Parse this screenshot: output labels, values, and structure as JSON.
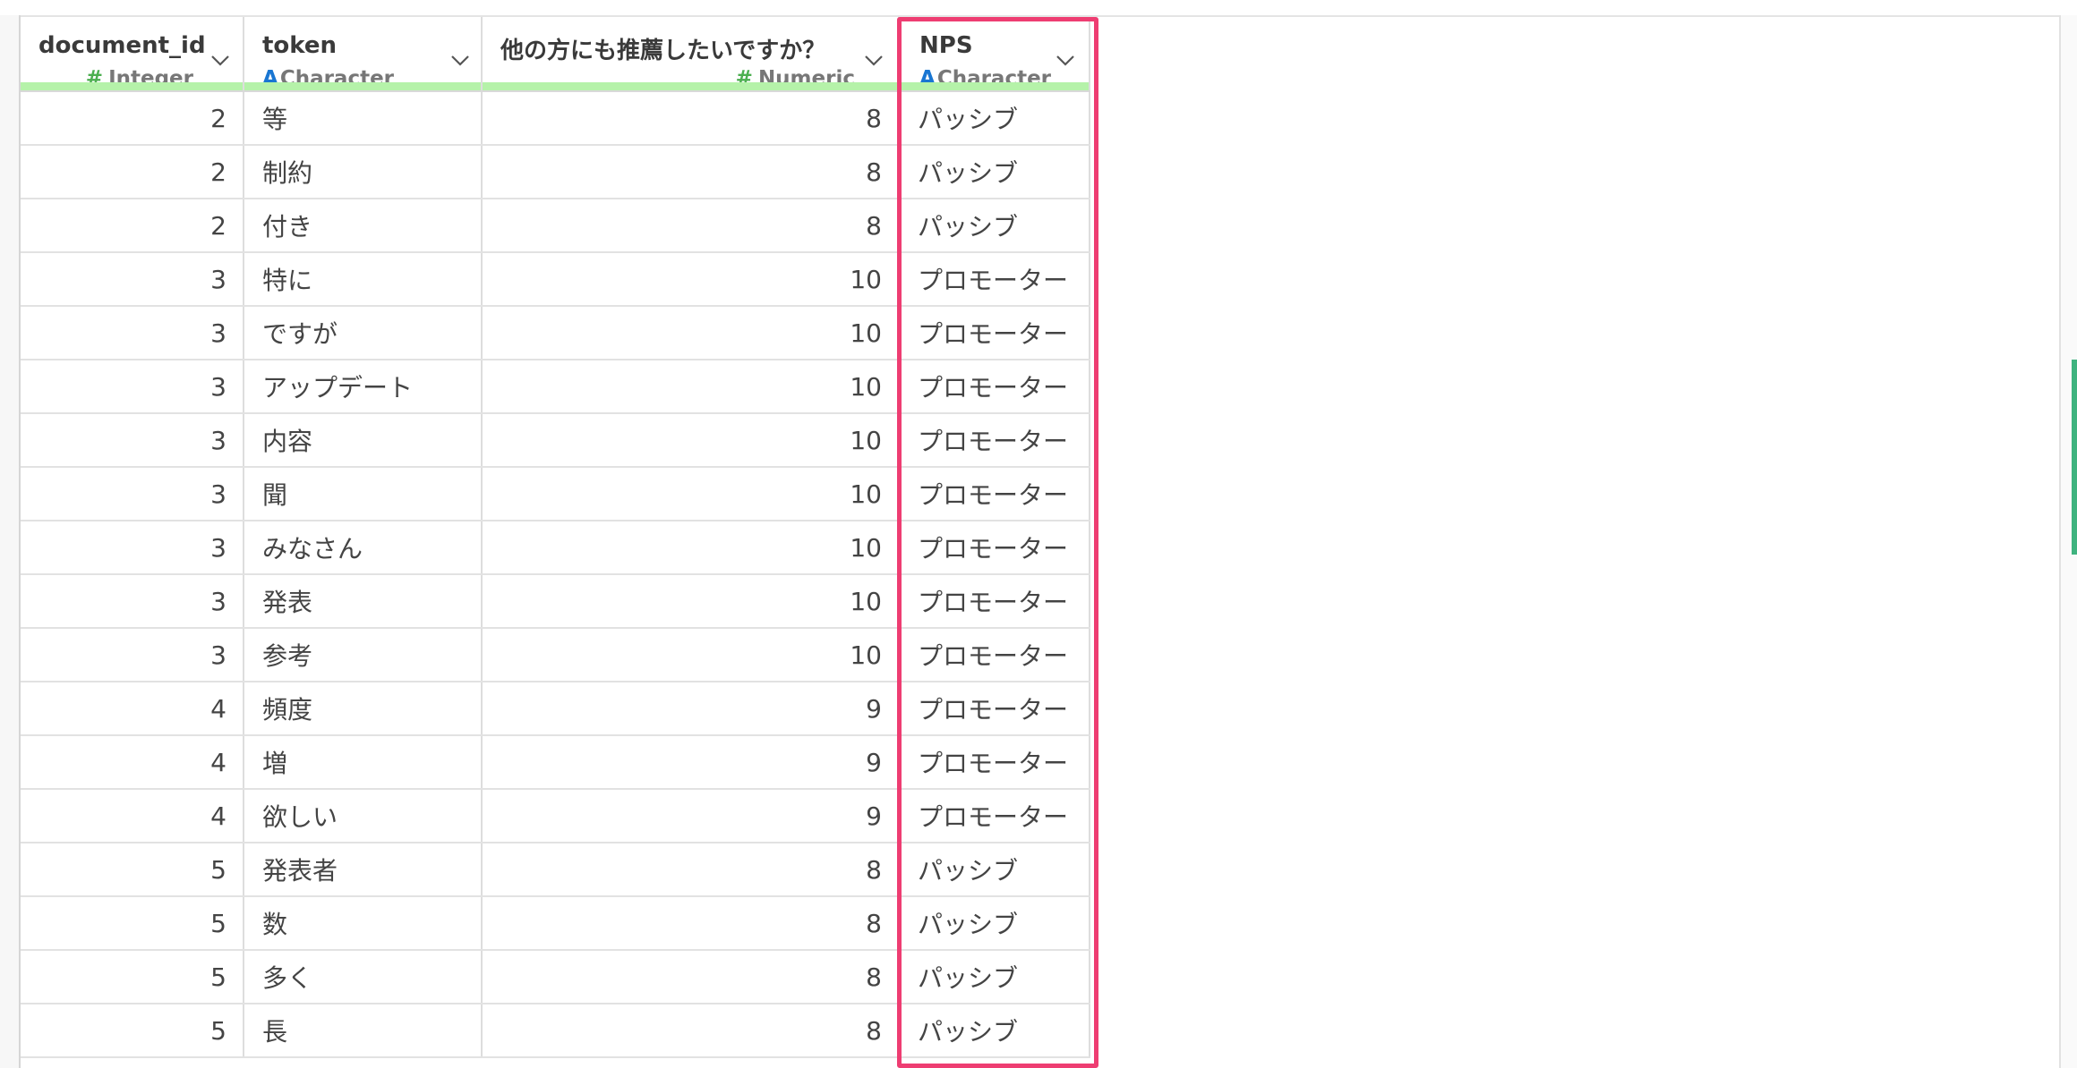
{
  "columns": [
    {
      "name": "document_id",
      "type_icon": "#",
      "type": "Integer"
    },
    {
      "name": "token",
      "type_icon": "A",
      "type": "Character"
    },
    {
      "name": "他の方にも推薦したいですか？",
      "type_icon": "#",
      "type": "Numeric"
    },
    {
      "name": "NPS",
      "type_icon": "A",
      "type": "Character"
    }
  ],
  "rows": [
    [
      "2",
      "等",
      "8",
      "パッシブ"
    ],
    [
      "2",
      "制約",
      "8",
      "パッシブ"
    ],
    [
      "2",
      "付き",
      "8",
      "パッシブ"
    ],
    [
      "3",
      "特に",
      "10",
      "プロモーター"
    ],
    [
      "3",
      "ですが",
      "10",
      "プロモーター"
    ],
    [
      "3",
      "アップデート",
      "10",
      "プロモーター"
    ],
    [
      "3",
      "内容",
      "10",
      "プロモーター"
    ],
    [
      "3",
      "聞",
      "10",
      "プロモーター"
    ],
    [
      "3",
      "みなさん",
      "10",
      "プロモーター"
    ],
    [
      "3",
      "発表",
      "10",
      "プロモーター"
    ],
    [
      "3",
      "参考",
      "10",
      "プロモーター"
    ],
    [
      "4",
      "頻度",
      "9",
      "プロモーター"
    ],
    [
      "4",
      "増",
      "9",
      "プロモーター"
    ],
    [
      "4",
      "欲しい",
      "9",
      "プロモーター"
    ],
    [
      "5",
      "発表者",
      "8",
      "パッシブ"
    ],
    [
      "5",
      "数",
      "8",
      "パッシブ"
    ],
    [
      "5",
      "多く",
      "8",
      "パッシブ"
    ],
    [
      "5",
      "長",
      "8",
      "パッシブ"
    ]
  ],
  "colors": {
    "header_bar": "#b5f2a9",
    "highlight": "#ee3d72",
    "numeric_icon": "#4caf50",
    "character_icon": "#1976d2",
    "scroll_indicator": "#3fb37f"
  }
}
